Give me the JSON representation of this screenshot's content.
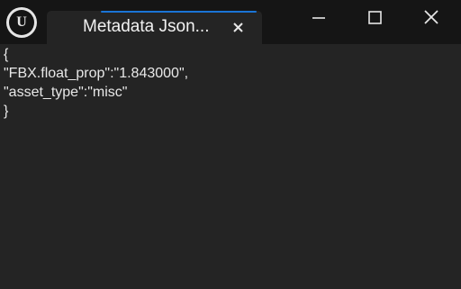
{
  "window": {
    "app_icon": "unreal-engine-logo",
    "app_icon_glyph": "U",
    "tab": {
      "title": "Metadata Json...",
      "close_icon": "close-icon"
    },
    "controls": {
      "minimize_icon": "minimize-icon",
      "maximize_icon": "maximize-icon",
      "close_icon": "close-icon"
    }
  },
  "content": {
    "lines": [
      "{",
      "\"FBX.float_prop\":\"1.843000\",",
      "\"asset_type\":\"misc\"",
      "}"
    ]
  },
  "colors": {
    "titlebar_bg": "#151515",
    "content_bg": "#242424",
    "tab_accent": "#1a74d6",
    "text": "#e8e8e8"
  }
}
